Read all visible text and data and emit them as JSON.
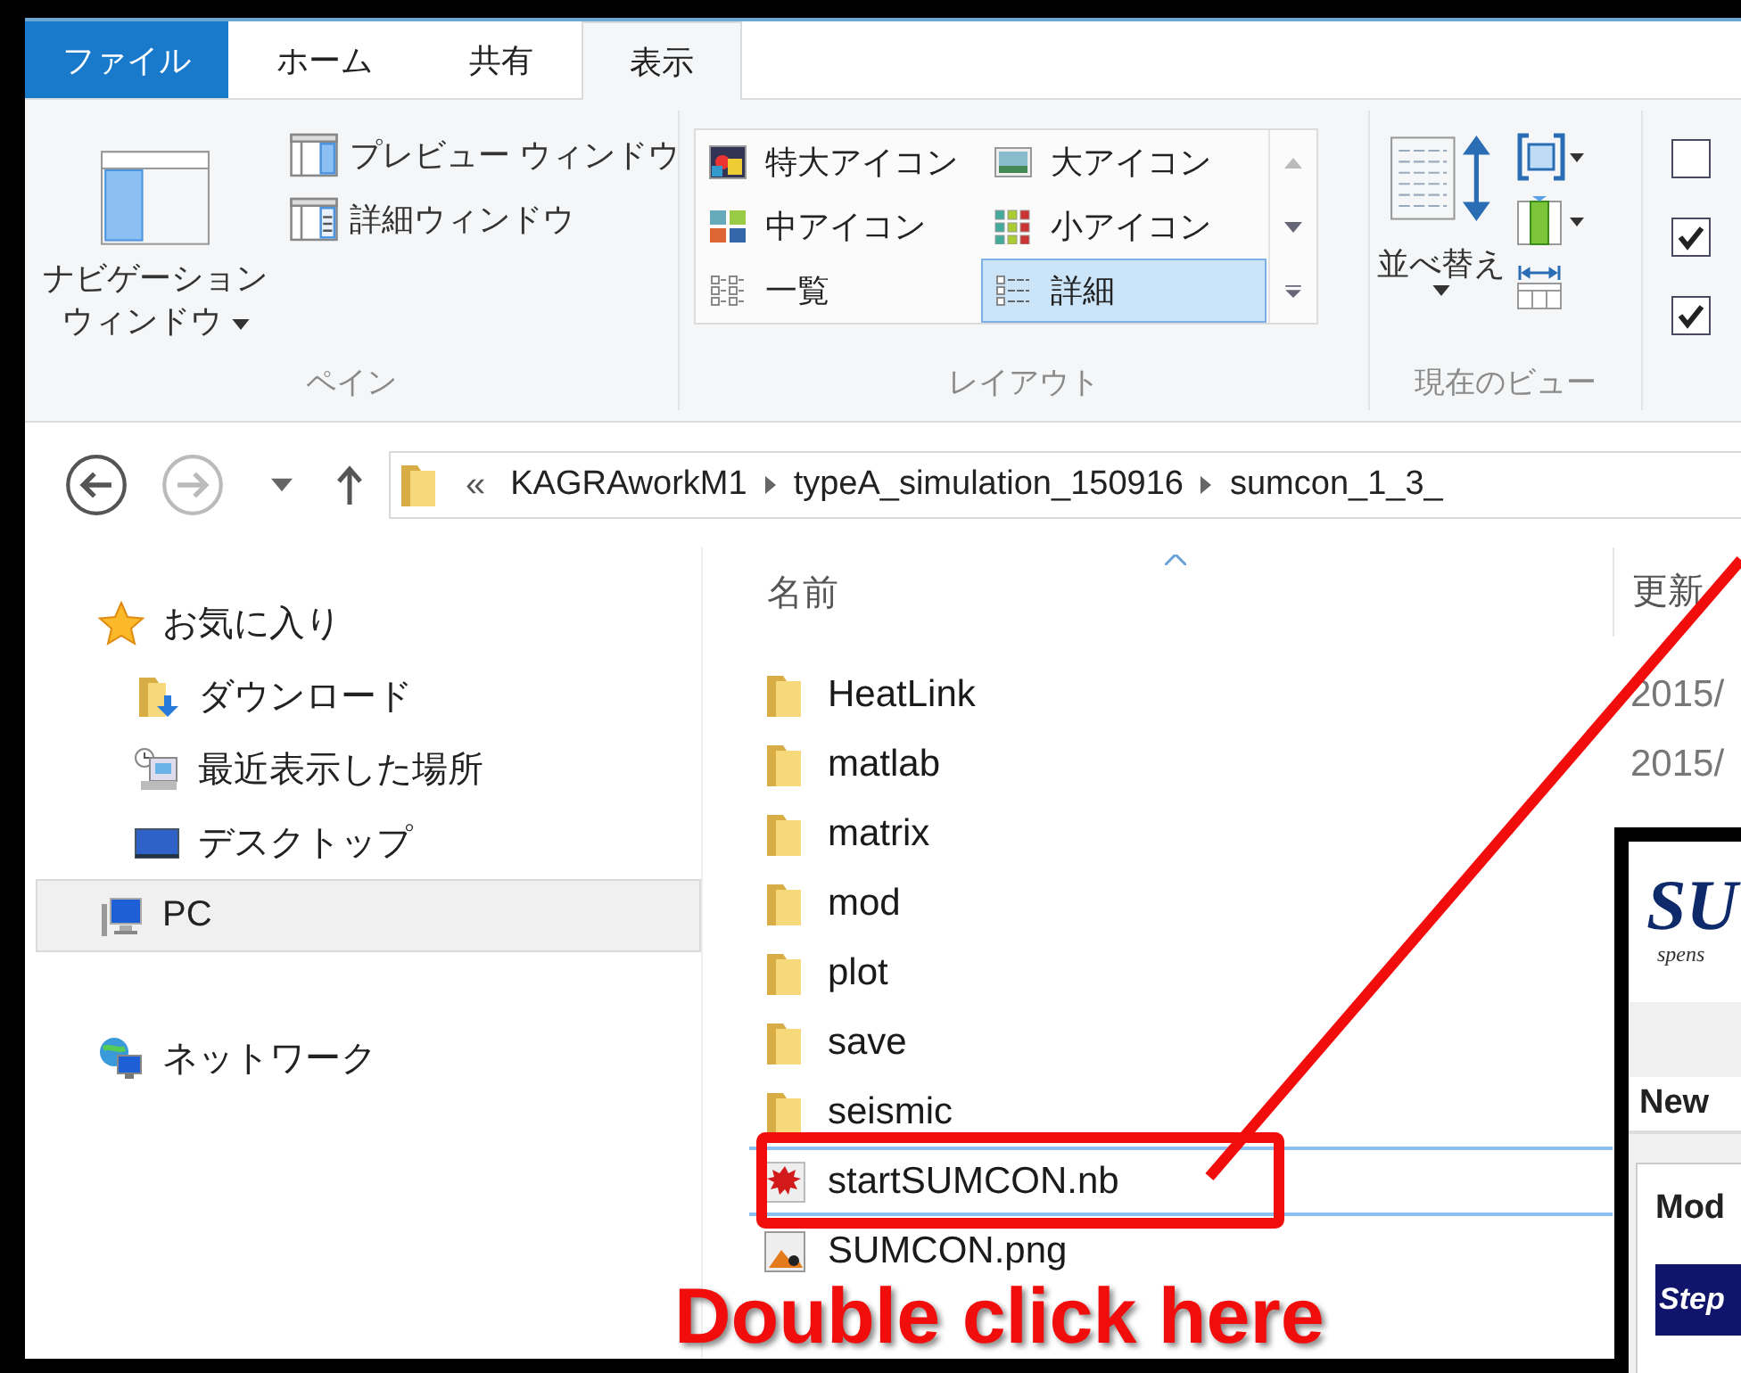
{
  "ribbon_tabs": [
    {
      "label": "ファイル",
      "kind": "file",
      "selected": false
    },
    {
      "label": "ホーム",
      "kind": "tab",
      "selected": false
    },
    {
      "label": "共有",
      "kind": "tab",
      "selected": false
    },
    {
      "label": "表示",
      "kind": "tab",
      "selected": true
    }
  ],
  "pane_group": {
    "nav_button": [
      "ナビゲーション",
      "ウィンドウ"
    ],
    "items": [
      {
        "label": "プレビュー ウィンドウ",
        "kind": "preview"
      },
      {
        "label": "詳細ウィンドウ",
        "kind": "details"
      }
    ],
    "label": "ペイン"
  },
  "layout_group": {
    "items": [
      {
        "label": "特大アイコン",
        "kind": "xl",
        "selected": false
      },
      {
        "label": "大アイコン",
        "kind": "large",
        "selected": false
      },
      {
        "label": "中アイコン",
        "kind": "medium",
        "selected": false
      },
      {
        "label": "小アイコン",
        "kind": "small",
        "selected": false
      },
      {
        "label": "一覧",
        "kind": "list",
        "selected": false
      },
      {
        "label": "詳細",
        "kind": "details",
        "selected": true
      }
    ],
    "label": "レイアウト"
  },
  "current_view": {
    "sort_label": "並べ替え",
    "label": "現在のビュー"
  },
  "view_checkboxes": [
    {
      "checked": false
    },
    {
      "checked": true
    },
    {
      "checked": true
    }
  ],
  "address": {
    "overflow": "«",
    "crumbs": [
      "KAGRAworkM1",
      "typeA_simulation_150916",
      "sumcon_1_3_"
    ]
  },
  "nav": [
    {
      "label": "お気に入り",
      "kind": "favorites",
      "selected": false,
      "children": [
        {
          "label": "ダウンロード",
          "kind": "downloads",
          "selected": false
        },
        {
          "label": "最近表示した場所",
          "kind": "recent",
          "selected": false
        },
        {
          "label": "デスクトップ",
          "kind": "desktop",
          "selected": false
        }
      ]
    },
    {
      "label": "PC",
      "kind": "pc",
      "selected": true
    },
    {
      "label": "ネットワーク",
      "kind": "network",
      "selected": false
    }
  ],
  "files": {
    "columns": [
      "名前",
      "更新"
    ],
    "rows": [
      {
        "name": "HeatLink",
        "kind": "folder",
        "date": "2015/",
        "selected": false
      },
      {
        "name": "matlab",
        "kind": "folder",
        "date": "2015/",
        "selected": false
      },
      {
        "name": "matrix",
        "kind": "folder",
        "selected": false
      },
      {
        "name": "mod",
        "kind": "folder",
        "selected": false
      },
      {
        "name": "plot",
        "kind": "folder",
        "selected": false
      },
      {
        "name": "save",
        "kind": "folder",
        "selected": false
      },
      {
        "name": "seismic",
        "kind": "folder",
        "selected": false
      },
      {
        "name": "startSUMCON.nb",
        "kind": "notebook",
        "selected": true
      },
      {
        "name": "SUMCON.png",
        "kind": "image",
        "selected": false
      }
    ]
  },
  "annotation": {
    "caption": "Double click here"
  },
  "inset": {
    "logo": "SU",
    "tagline": "spens",
    "tab": "New",
    "section": "Mod",
    "step": "Step"
  }
}
